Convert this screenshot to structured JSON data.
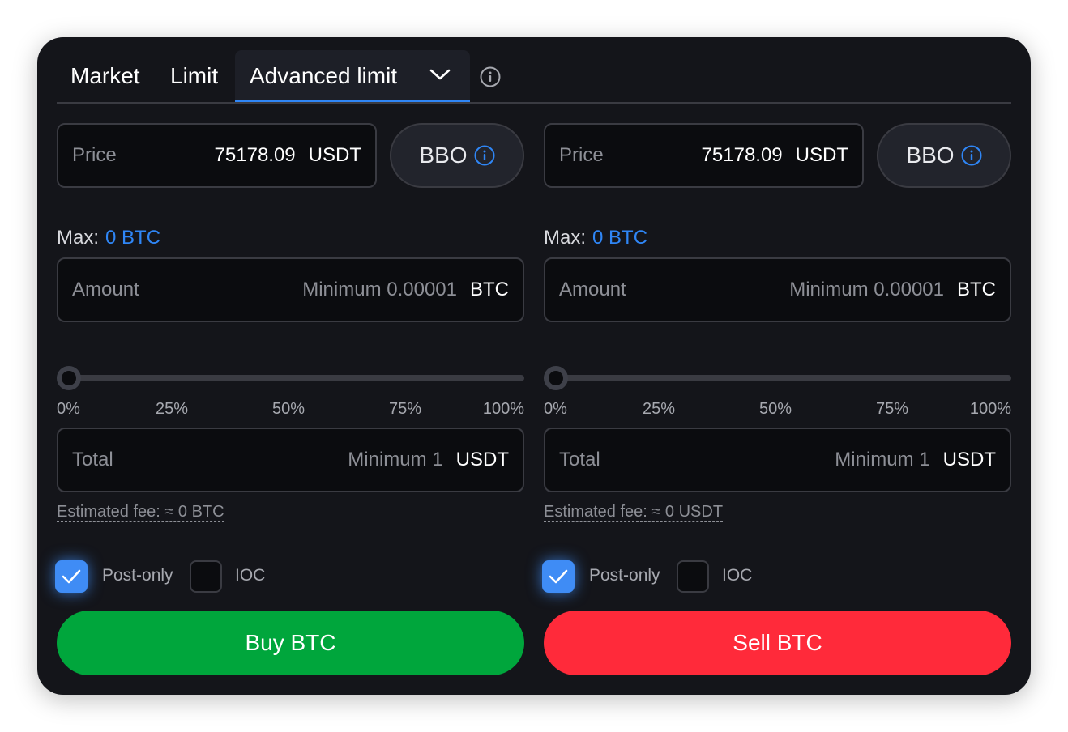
{
  "tabs": {
    "market": "Market",
    "limit": "Limit",
    "advanced": "Advanced limit",
    "active": "Advanced limit"
  },
  "buy": {
    "price_label": "Price",
    "price_value": "75178.09",
    "price_unit": "USDT",
    "bbo_label": "BBO",
    "max_label": "Max:",
    "max_value": "0 BTC",
    "amount_label": "Amount",
    "amount_placeholder": "Minimum 0.00001",
    "amount_unit": "BTC",
    "slider_percent": 0,
    "ticks": [
      "0%",
      "25%",
      "50%",
      "75%",
      "100%"
    ],
    "total_label": "Total",
    "total_placeholder": "Minimum 1",
    "total_unit": "USDT",
    "fee": "Estimated fee: ≈ 0 BTC",
    "post_only_label": "Post-only",
    "post_only_checked": true,
    "ioc_label": "IOC",
    "ioc_checked": false,
    "action_label": "Buy BTC",
    "action_color": "#00a63c"
  },
  "sell": {
    "price_label": "Price",
    "price_value": "75178.09",
    "price_unit": "USDT",
    "bbo_label": "BBO",
    "max_label": "Max:",
    "max_value": "0 BTC",
    "amount_label": "Amount",
    "amount_placeholder": "Minimum 0.00001",
    "amount_unit": "BTC",
    "slider_percent": 0,
    "ticks": [
      "0%",
      "25%",
      "50%",
      "75%",
      "100%"
    ],
    "total_label": "Total",
    "total_placeholder": "Minimum 1",
    "total_unit": "USDT",
    "fee": "Estimated fee: ≈ 0 USDT",
    "post_only_label": "Post-only",
    "post_only_checked": true,
    "ioc_label": "IOC",
    "ioc_checked": false,
    "action_label": "Sell BTC",
    "action_color": "#ff2a3a"
  },
  "colors": {
    "accent": "#2f86f6",
    "card_bg": "#14151a",
    "field_bg": "#0b0c0f"
  },
  "icons": {
    "tab_chevron": "chevron-down-icon",
    "tab_info": "info-icon",
    "bbo_info": "info-icon",
    "checkmark": "checkmark-icon"
  }
}
